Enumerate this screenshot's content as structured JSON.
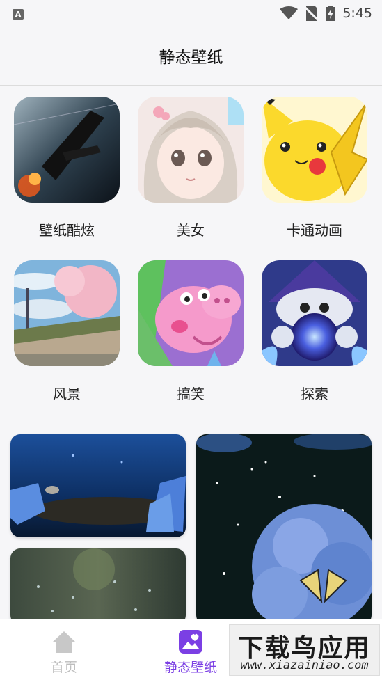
{
  "status_bar": {
    "app_icon_letter": "A",
    "time": "5:45"
  },
  "header": {
    "title": "静态壁纸"
  },
  "categories": [
    {
      "label": "壁纸酷炫"
    },
    {
      "label": "美女"
    },
    {
      "label": "卡通动画"
    },
    {
      "label": "风景"
    },
    {
      "label": "搞笑"
    },
    {
      "label": "探索"
    }
  ],
  "bottom_nav": {
    "items": [
      {
        "label": "首页",
        "active": false
      },
      {
        "label": "静态壁纸",
        "active": true
      }
    ],
    "active_color": "#7b3fe4",
    "inactive_color": "#bdbdbd"
  },
  "watermark": {
    "logo_text": "下载鸟应用",
    "url_text": "www.xiazainiao.com"
  }
}
